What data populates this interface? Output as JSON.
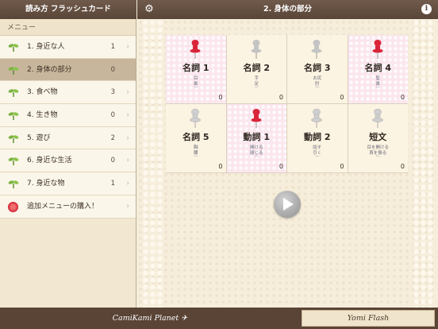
{
  "header": {
    "left_title": "読み方 フラッシュカード",
    "right_title": "2. 身体の部分",
    "settings_icon": "gear-icon",
    "info_icon": "info-icon"
  },
  "sidebar": {
    "header": "メニュー",
    "items": [
      {
        "label": "1. 身近な人",
        "count": "1",
        "selected": false
      },
      {
        "label": "2. 身体の部分",
        "count": "0",
        "selected": true
      },
      {
        "label": "3. 食べ物",
        "count": "3",
        "selected": false
      },
      {
        "label": "4. 生き物",
        "count": "0",
        "selected": false
      },
      {
        "label": "5. 遊び",
        "count": "2",
        "selected": false
      },
      {
        "label": "6. 身近な生活",
        "count": "0",
        "selected": false
      },
      {
        "label": "7. 身近な物",
        "count": "1",
        "selected": false
      }
    ],
    "purchase_label": "追加メニューの購入！"
  },
  "cards": [
    {
      "name": "名詞 1",
      "lines": [
        "目",
        "鼻",
        "—"
      ],
      "count": "0",
      "pin": "red",
      "bg": "pink"
    },
    {
      "name": "名詞 2",
      "lines": [
        "手",
        "足",
        "—"
      ],
      "count": "0",
      "pin": "gray",
      "bg": "cream"
    },
    {
      "name": "名詞 3",
      "lines": [
        "お尻",
        "肘",
        "—"
      ],
      "count": "0",
      "pin": "gray",
      "bg": "cream"
    },
    {
      "name": "名詞 4",
      "lines": [
        "髪",
        "鼻",
        "—"
      ],
      "count": "0",
      "pin": "red",
      "bg": "pink"
    },
    {
      "name": "名詞 5",
      "lines": [
        "胸",
        "腰",
        "—"
      ],
      "count": "0",
      "pin": "none",
      "bg": "cream"
    },
    {
      "name": "動詞 1",
      "lines": [
        "開ける",
        "閉じる",
        "—"
      ],
      "count": "0",
      "pin": "red",
      "bg": "pink"
    },
    {
      "name": "動詞 2",
      "lines": [
        "話す",
        "引く",
        "—"
      ],
      "count": "0",
      "pin": "none",
      "bg": "cream"
    },
    {
      "name": "短文",
      "lines": [
        "目を開ける",
        "首を振る",
        "—"
      ],
      "count": "0",
      "pin": "none",
      "bg": "cream"
    }
  ],
  "play_icon": "play-icon",
  "footer": {
    "brand": "CamiKami Planet ✈",
    "yomi_button": "Yomi Flash"
  },
  "colors": {
    "topbar": "#5a4638",
    "selected_menu": "#c7b69c",
    "pin_red": "#d9253a",
    "pin_gray": "#c4c4c4"
  }
}
